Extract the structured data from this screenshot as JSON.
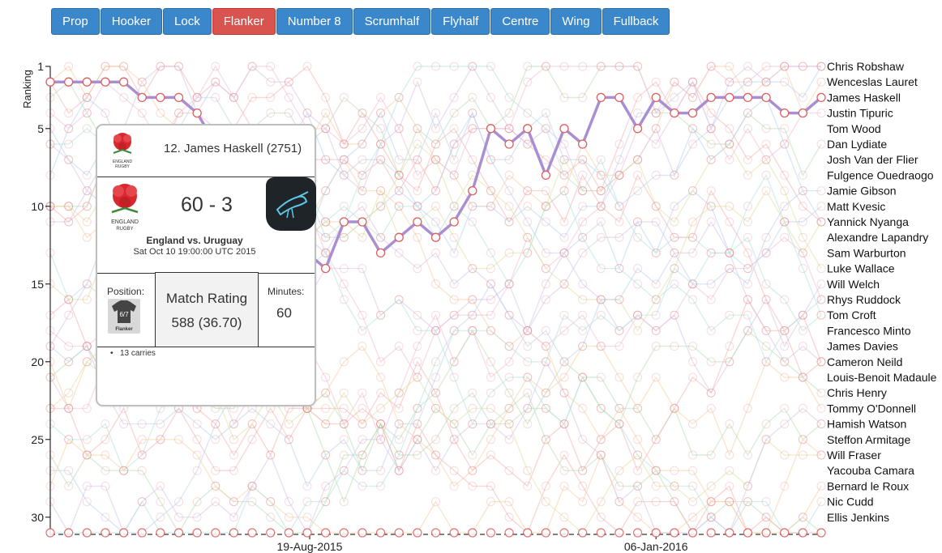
{
  "positions": {
    "tabs": [
      "Prop",
      "Hooker",
      "Lock",
      "Flanker",
      "Number 8",
      "Scrumhalf",
      "Flyhalf",
      "Centre",
      "Wing",
      "Fullback"
    ],
    "active": "Flanker"
  },
  "chart_data": {
    "type": "line",
    "ylabel": "Ranking",
    "y_ticks": [
      1,
      5,
      10,
      15,
      20,
      25,
      30
    ],
    "ylim": [
      1,
      31
    ],
    "y_inverted": true,
    "x_ticks": [
      "19-Aug-2015",
      "06-Jan-2016"
    ],
    "legend_placement": "right",
    "players": [
      "Chris Robshaw",
      "Wenceslas Lauret",
      "James Haskell",
      "Justin Tipuric",
      "Tom Wood",
      "Dan Lydiate",
      "Josh Van der Flier",
      "Fulgence Ouedraogo",
      "Jamie Gibson",
      "Matt Kvesic",
      "Yannick Nyanga",
      "Alexandre Lapandry",
      "Sam Warburton",
      "Luke Wallace",
      "Will Welch",
      "Rhys Ruddock",
      "Tom Croft",
      "Francesco Minto",
      "James Davies",
      "Cameron Neild",
      "Louis-Benoit Madaule",
      "Chris Henry",
      "Tommy O'Donnell",
      "Hamish Watson",
      "Steffon Armitage",
      "Will Fraser",
      "Yacouba Camara",
      "Bernard le Roux",
      "Nic Cudd",
      "Ellis Jenkins"
    ],
    "highlight": {
      "name": "James Haskell",
      "ranks": [
        2,
        2,
        2,
        2,
        2,
        3,
        3,
        3,
        4,
        6,
        11,
        15,
        17,
        12,
        13,
        14,
        11,
        11,
        13,
        12,
        11,
        12,
        11,
        9,
        5,
        6,
        5,
        8,
        5,
        6,
        3,
        3,
        5,
        3,
        4,
        4,
        3,
        3,
        3,
        3,
        4,
        4,
        3
      ],
      "missing_rank": 31
    },
    "background_series_count": 30
  },
  "tooltip": {
    "player": "12. James Haskell (2751)",
    "score": "60 - 3",
    "match": "England vs. Uruguay",
    "date": "Sat Oct 10 19:00:00 UTC 2015",
    "position_label": "Position:",
    "position_name": "Flanker",
    "shirt_number": "6/7",
    "rating_title": "Match Rating",
    "rating_value": "588 (36.70)",
    "minutes_label": "Minutes:",
    "minutes_value": "60",
    "stats": [
      "13 carries"
    ],
    "crest_text": "ENGLAND RUGBY"
  },
  "colors": {
    "highlight_line": "#a98fd1",
    "marker_stroke": "#e06060",
    "active_tab": "#d9534f",
    "tab": "#3a87cc",
    "background_palette": [
      "#f4b6b6",
      "#b9dfb9",
      "#bcd3ee",
      "#f5d2a6",
      "#d6c6ea",
      "#b7e3df",
      "#eec2da",
      "#dfe2a6"
    ]
  }
}
